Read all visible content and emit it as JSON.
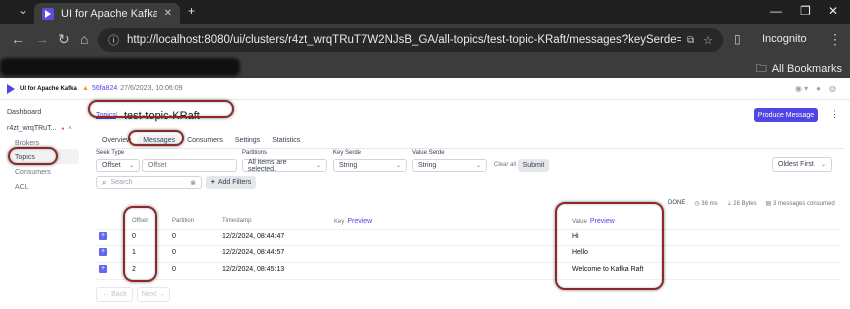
{
  "browser": {
    "tab_title": "UI for Apache Kafka",
    "url": "http://localhost:8080/ui/clusters/r4zt_wrqTRuT7W2NJsB_GA/all-topics/test-topic-KRaft/messages?keySerde=String&valueSerde=Str...",
    "incognito_label": "Incognito",
    "all_bookmarks_label": "All Bookmarks"
  },
  "app": {
    "title": "UI for Apache Kafka",
    "version_hash": "56fa824",
    "version_date": "27/6/2023, 10:06:09"
  },
  "sidebar": {
    "items": [
      {
        "label": "Dashboard"
      },
      {
        "label": "r4zt_wrqTRuT..."
      },
      {
        "label": "Brokers"
      },
      {
        "label": "Topics"
      },
      {
        "label": "Consumers"
      },
      {
        "label": "ACL"
      }
    ]
  },
  "breadcrumb": {
    "parent": "Topics",
    "separator": "/",
    "current": "test-topic-KRaft"
  },
  "produce_button": "Produce Message",
  "tabs": [
    "Overview",
    "Messages",
    "Consumers",
    "Settings",
    "Statistics"
  ],
  "filters": {
    "seek_type_label": "Seek Type",
    "seek_type_value": "Offset",
    "offset_placeholder": "Offset",
    "partitions_label": "Partitions",
    "partitions_value": "All items are selected.",
    "key_serde_label": "Key Serde",
    "key_serde_value": "String",
    "value_serde_label": "Value Serde",
    "value_serde_value": "String",
    "clear_all": "Clear all",
    "submit": "Submit",
    "sort_value": "Oldest First",
    "search_placeholder": "Search",
    "add_filters": "Add Filters"
  },
  "stats": {
    "status": "DONE",
    "elapsed": "36 ms",
    "bytes": "28 Bytes",
    "consumed": "3 messages consumed"
  },
  "table": {
    "headers": {
      "offset": "Offset",
      "partition": "Partition",
      "timestamp": "Timestamp",
      "key": "Key",
      "value": "Value",
      "preview": "Preview"
    },
    "rows": [
      {
        "offset": "0",
        "partition": "0",
        "timestamp": "12/2/2024, 08:44:47",
        "value": "Hi"
      },
      {
        "offset": "1",
        "partition": "0",
        "timestamp": "12/2/2024, 08:44:57",
        "value": "Hello"
      },
      {
        "offset": "2",
        "partition": "0",
        "timestamp": "12/2/2024, 08:45:13",
        "value": "Welcome to Kafka Raft"
      }
    ]
  },
  "pager": {
    "back": "← Back",
    "next": "Next →"
  },
  "colors": {
    "accent": "#4f46e5",
    "annotation_ring": "#8b2a2a"
  }
}
